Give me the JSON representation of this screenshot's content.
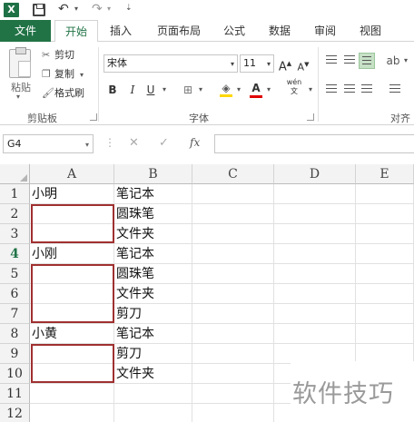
{
  "app": {
    "logo_text": "X"
  },
  "tabs": [
    "文件",
    "开始",
    "插入",
    "页面布局",
    "公式",
    "数据",
    "审阅",
    "视图"
  ],
  "ribbon": {
    "paste_label": "粘贴",
    "cut_label": "剪切",
    "copy_label": "复制",
    "format_painter_label": "格式刷",
    "clipboard_group": "剪贴板",
    "font_name": "宋体",
    "font_size": "11",
    "font_group": "字体",
    "align_group": "对齐",
    "bold": "B",
    "italic": "I",
    "underline": "U",
    "grow_font": "A",
    "shrink_font": "A",
    "font_color": "A",
    "phonetic": "wén"
  },
  "formula_bar": {
    "name_box": "G4",
    "cancel": "✕",
    "enter": "✓",
    "fx": "fx",
    "value": ""
  },
  "columns": [
    "A",
    "B",
    "C",
    "D",
    "E"
  ],
  "rows": [
    "1",
    "2",
    "3",
    "4",
    "5",
    "6",
    "7",
    "8",
    "9",
    "10",
    "11",
    "12"
  ],
  "selected_row": "4",
  "cells": {
    "A": [
      "小明",
      "",
      "",
      "小刚",
      "",
      "",
      "",
      "小黄",
      "",
      "",
      "",
      ""
    ],
    "B": [
      "笔记本",
      "圆珠笔",
      "文件夹",
      "笔记本",
      "圆珠笔",
      "文件夹",
      "剪刀",
      "笔记本",
      "剪刀",
      "文件夹",
      "",
      ""
    ]
  },
  "watermark": "软件技巧",
  "colors": {
    "excel_green": "#217346",
    "highlight_red": "#a03030"
  }
}
